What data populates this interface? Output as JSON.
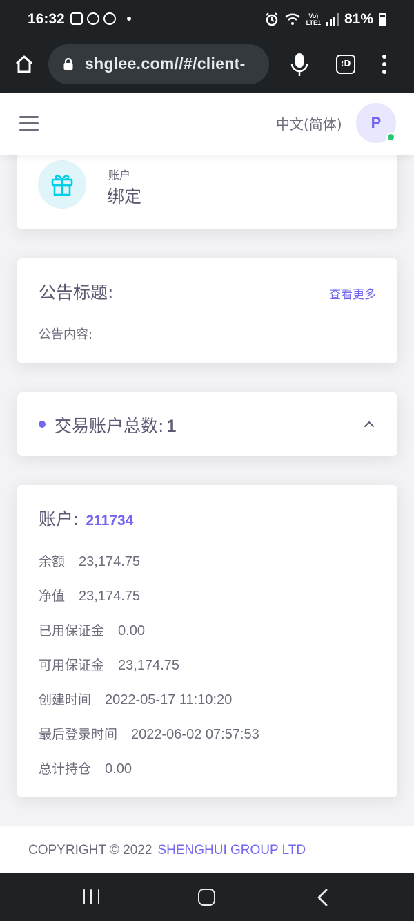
{
  "status_bar": {
    "time": "16:32",
    "network": "LTE1",
    "battery": "81%"
  },
  "browser": {
    "url": "shglee.com//#/client-"
  },
  "header": {
    "language": "中文(简体)",
    "avatar_initial": "P"
  },
  "bind_card": {
    "small_label": "账户",
    "big_label": "绑定"
  },
  "notice": {
    "title": "公告标题:",
    "more_link": "查看更多",
    "content": "公告内容:"
  },
  "summary": {
    "label": "交易账户总数:",
    "count": "1"
  },
  "account": {
    "title_label": "账户:",
    "number": "211734",
    "rows": [
      {
        "label": "余额",
        "value": "23,174.75"
      },
      {
        "label": "净值",
        "value": "23,174.75"
      },
      {
        "label": "已用保证金",
        "value": "0.00"
      },
      {
        "label": "可用保证金",
        "value": "23,174.75"
      },
      {
        "label": "创建时间",
        "value": "2022-05-17 11:10:20"
      },
      {
        "label": "最后登录时间",
        "value": "2022-06-02 07:57:53"
      },
      {
        "label": "总计持仓",
        "value": "0.00"
      }
    ]
  },
  "footer": {
    "copyright": "COPYRIGHT © 2022",
    "company": "SHENGHUI GROUP LTD"
  },
  "colors": {
    "primary": "#7367f0",
    "info_bg": "#dff5f9",
    "info": "#00cfe8",
    "success": "#28c76f",
    "system_bar": "#1f2225"
  }
}
